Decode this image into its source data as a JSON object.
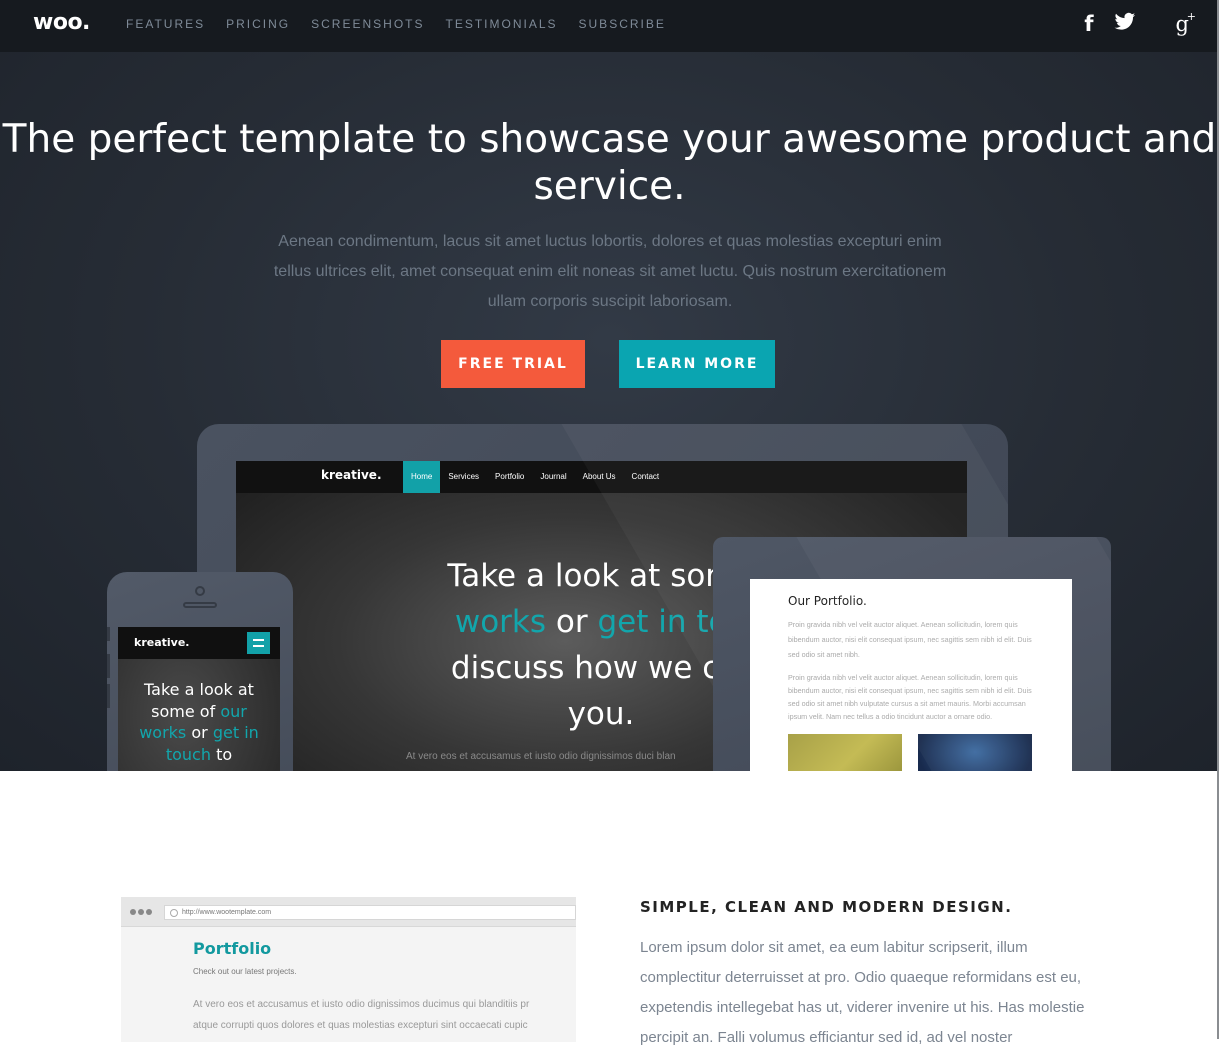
{
  "navbar": {
    "logo": "woo.",
    "links": [
      "FEATURES",
      "PRICING",
      "SCREENSHOTS",
      "TESTIMONIALS",
      "SUBSCRIBE"
    ],
    "social": [
      {
        "icon": "facebook-icon",
        "glyph": "f"
      },
      {
        "icon": "twitter-icon",
        "glyph": "🐦"
      },
      {
        "icon": "google-plus-icon",
        "glyph": "g"
      }
    ]
  },
  "hero": {
    "title": "The perfect template to showcase your awesome product and service.",
    "subtitle": "Aenean condimentum, lacus sit amet luctus lobortis, dolores et quas molestias excepturi enim tellus ultrices elit, amet consequat enim elit noneas sit amet luctu. Quis nostrum exercitationem ullam corporis suscipit laboriosam.",
    "cta_primary": "FREE TRIAL",
    "cta_secondary": "LEARN MORE",
    "colors": {
      "primary": "#f45a3c",
      "secondary": "#0aa5b1",
      "background": "#262c35"
    }
  },
  "desktop_mockup": {
    "logo": "kreative.",
    "menu": [
      "Home",
      "Services",
      "Portfolio",
      "Journal",
      "About Us",
      "Contact"
    ],
    "headline": {
      "line1": "Take a look at some",
      "teal1": "works",
      "mid": "or",
      "teal2": "get in tou",
      "line3": "discuss how we car",
      "line4": "you."
    },
    "small_text": "At vero eos et accusamus et iusto odio dignissimos duci blan"
  },
  "phone_mockup": {
    "logo": "kreative.",
    "headline": {
      "part1": "Take a look at some of",
      "teal1": "our works",
      "mid": "or",
      "teal2": "get in touch",
      "part2": "to"
    }
  },
  "tablet_mockup": {
    "title": "Our Portfolio.",
    "para1": "Proin gravida nibh vel velit auctor aliquet. Aenean sollicitudin, lorem quis bibendum auctor, nisi elit consequat ipsum, nec sagittis sem nibh id elit. Duis sed odio sit amet nibh.",
    "para2": "Proin gravida nibh vel velit auctor aliquet. Aenean sollicitudin, lorem quis bibendum auctor, nisi elit consequat ipsum, nec sagittis sem nibh id elit. Duis sed odio sit amet nibh vulputate cursus a sit amet mauris. Morbi accumsan ipsum velit. Nam nec tellus a odio tincidunt auctor a ornare odio."
  },
  "feature_section": {
    "browser": {
      "url": "http://www.wootemplate.com",
      "title": "Portfolio",
      "subtitle": "Check out our latest projects.",
      "body_line1": "At vero eos et accusamus et iusto odio dignissimos ducimus qui blanditiis pr",
      "body_line2": "atque corrupti quos dolores et quas molestias excepturi sint occaecati cupic"
    },
    "title": "SIMPLE, CLEAN AND MODERN DESIGN.",
    "body": "Lorem ipsum dolor sit amet, ea eum labitur scripserit, illum complectitur deterruisset at pro. Odio quaeque reformidans est eu, expetendis intellegebat has ut, viderer invenire ut his. Has molestie percipit an. Falli volumus efficiantur sed id, ad vel noster"
  }
}
